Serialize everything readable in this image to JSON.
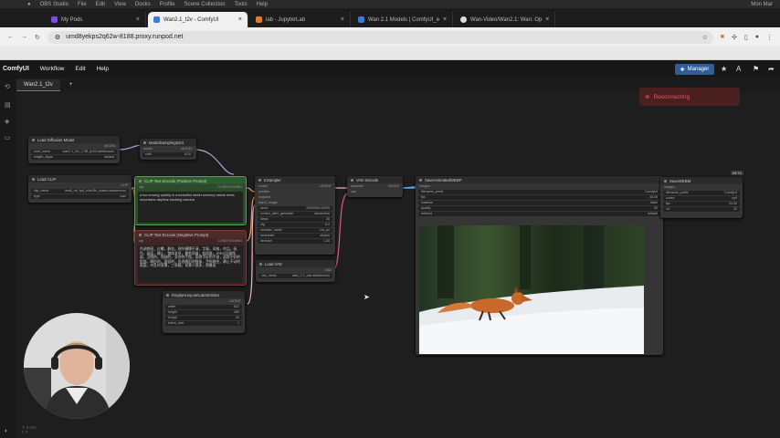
{
  "menubar": {
    "items": [
      "OBS Studio",
      "File",
      "Edit",
      "View",
      "Docks",
      "Profile",
      "Scene Collection",
      "Tools",
      "Help"
    ],
    "right": "Mon Mar"
  },
  "browser_tabs": [
    {
      "label": "My Pods"
    },
    {
      "label": "Wan2.1_t2v - ComfyUI",
      "active": true
    },
    {
      "label": "lab - JupyterLab"
    },
    {
      "label": "Wan 2.1 Models | ComfyUI_e"
    },
    {
      "label": "Wan-Video/Wan2.1: Wan: Op"
    }
  ],
  "address": {
    "url": "umd8yekps2q62w-8188.proxy.runpod.net"
  },
  "comfy": {
    "brand": "ComfyUI",
    "menu": [
      "Workflow",
      "Edit",
      "Help"
    ],
    "manager_label": "Manager",
    "workflow_tab": "Wan2.1_t2v",
    "add_tab": "+",
    "toast": "Reconnecting"
  },
  "nodes": {
    "load_diffusion": {
      "title": "Load Diffusion Model",
      "out": "MODEL",
      "unet_name_label": "unet_name",
      "unet_name": "wan2.1_t2v_1.3B_fp16.safetensors",
      "dtype_label": "weight_dtype",
      "dtype": "default"
    },
    "model_sampling": {
      "title": "ModelSamplingSD3",
      "in": "model",
      "out": "MODEL",
      "shift_label": "shift",
      "shift": "8.00"
    },
    "load_clip": {
      "title": "Load CLIP",
      "out": "CLIP",
      "clip_name_label": "clip_name",
      "clip_name": "umt5_xxl_fp8_e4m3fn_scaled.safetensors",
      "type_label": "type",
      "type": "wan"
    },
    "clip_pos": {
      "title": "CLIP Text Encode (Positive Prompt)",
      "in": "clip",
      "out": "CONDITIONING",
      "text": "a fox moving quickly in a beautiful winter scenery nature trees mountains daytime tracking camera"
    },
    "clip_neg": {
      "title": "CLIP Text Encode (Negative Prompt)",
      "in": "clip",
      "out": "CONDITIONING",
      "text": "色调艳丽，过曝，静态，细节模糊不清，字幕，风格，作品，画作，画面，静止，整体发灰，最差质量，低质量，JPEG压缩残留，丑陋的，残缺的，多余的手指，画得不好的手部，画得不好的脸部，畸形的，毁容的，形态畸形的肢体，手指融合，静止不动的画面，杂乱的背景，三条腿，背景人很多，倒着走"
    },
    "ksampler": {
      "title": "KSampler",
      "inputs": [
        "model",
        "positive",
        "negative",
        "latent_image"
      ],
      "out": "LATENT",
      "seed_label": "seed",
      "seed": "1052836144295",
      "control_label": "control_after_generate",
      "control": "randomize",
      "steps_label": "steps",
      "steps": "30",
      "cfg_label": "cfg",
      "cfg": "6.0",
      "sampler_label": "sampler_name",
      "sampler": "uni_pc",
      "scheduler_label": "scheduler",
      "scheduler": "simple",
      "denoise_label": "denoise",
      "denoise": "1.00"
    },
    "vae_decode": {
      "title": "VAE Decode",
      "inputs": [
        "samples",
        "vae"
      ],
      "out": "IMAGE"
    },
    "load_vae": {
      "title": "Load VAE",
      "out": "VAE",
      "vae_name_label": "vae_name",
      "vae_name": "wan_2.1_vae.safetensors"
    },
    "save_webp": {
      "title": "SaveAnimatedWEBP",
      "in": "images",
      "prefix_label": "filename_prefix",
      "prefix": "ComfyUI",
      "fps_label": "fps",
      "fps": "16.00",
      "lossless_label": "lossless",
      "lossless": "false",
      "quality_label": "quality",
      "quality": "90",
      "method_label": "method",
      "method": "default"
    },
    "save_webm": {
      "title": "SaveWEBM",
      "badge": "BETA",
      "in": "images",
      "prefix_label": "filename_prefix",
      "prefix": "ComfyUI",
      "codec_label": "codec",
      "codec": "vp9",
      "fps_label": "fps",
      "fps": "24.00",
      "crf_label": "crf",
      "crf": "32"
    },
    "empty_latent": {
      "title": "EmptyHunyuanLatentVideo",
      "out": "LATENT",
      "width_label": "width",
      "width": "832",
      "height_label": "height",
      "height": "480",
      "length_label": "length",
      "length": "33",
      "batch_label": "batch_size",
      "batch": "1"
    }
  },
  "footer": {
    "line1": "T: 0.00s",
    "line2": "I: 0"
  },
  "colors": {
    "accent": "#2e5d9a",
    "error": "#e35a5a",
    "positive": "#4fa34f",
    "negative": "#7a3a3a"
  }
}
